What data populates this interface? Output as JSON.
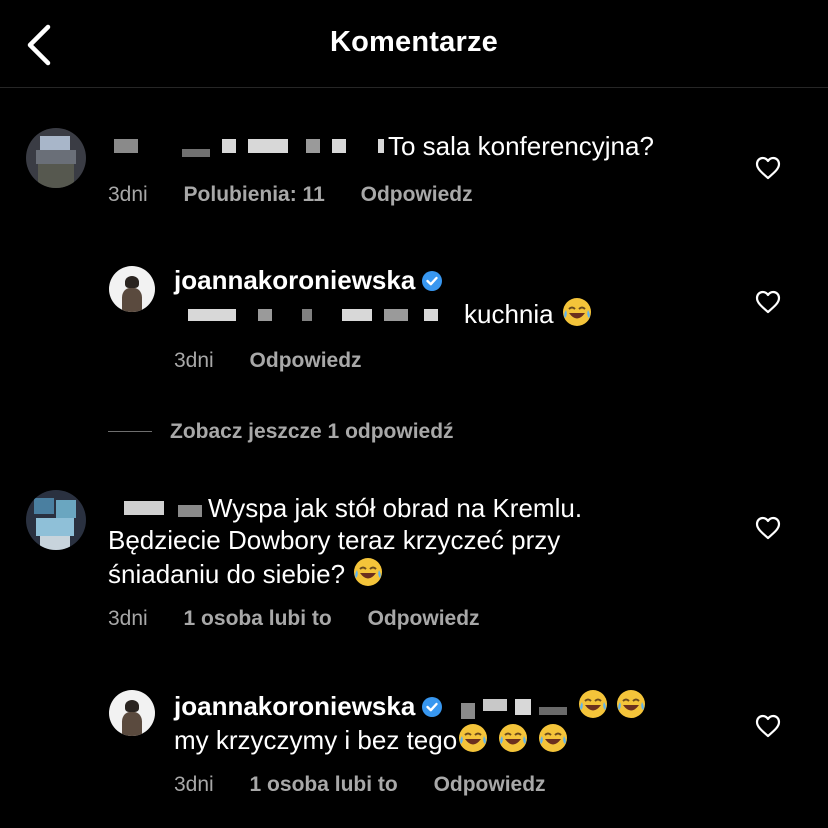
{
  "header": {
    "title": "Komentarze"
  },
  "comments": [
    {
      "text": "To sala konferencyjna?",
      "time": "3dni",
      "likes": "Polubienia: 11",
      "reply": "Odpowiedz"
    },
    {
      "username": "joannakoroniewska",
      "text": "kuchnia",
      "time": "3dni",
      "reply": "Odpowiedz"
    },
    {
      "text": "Wyspa jak stół obrad na Kremlu. Będziecie Dowbory teraz krzyczeć przy śniadaniu do siebie?",
      "time": "3dni",
      "likes": "1 osoba lubi to",
      "reply": "Odpowiedz"
    },
    {
      "username": "joannakoroniewska",
      "text": "my krzyczymy i bez tego",
      "time": "3dni",
      "likes": "1 osoba lubi to",
      "reply": "Odpowiedz"
    }
  ],
  "more_replies": "Zobacz jeszcze 1 odpowiedź",
  "icons": {
    "back": "chevron-left-icon",
    "like": "heart-icon",
    "verified": "verified-badge-icon",
    "emoji": "face-with-tears-of-joy"
  },
  "colors": {
    "background": "#000000",
    "text": "#ffffff",
    "secondary": "#a8a8a8",
    "verified": "#3897f0"
  }
}
